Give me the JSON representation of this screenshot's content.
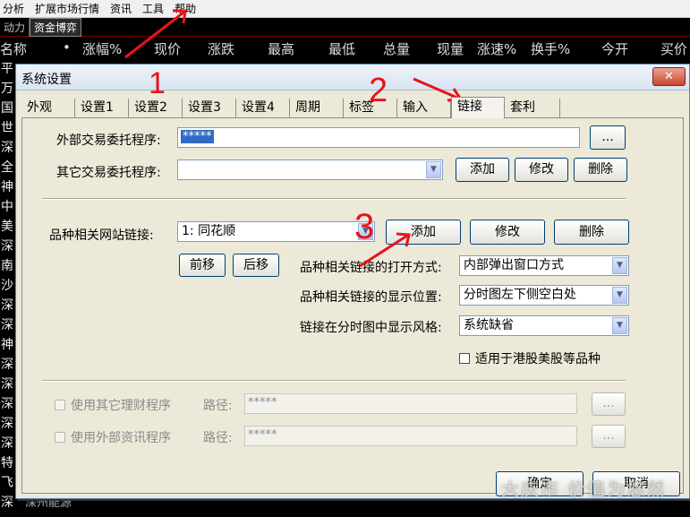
{
  "menubar": {
    "items": [
      "分析",
      "扩展市场行情",
      "资讯",
      "工具",
      "帮助"
    ]
  },
  "tabstrip": {
    "items": [
      "动力",
      "资金博弈"
    ]
  },
  "columns": [
    "名称",
    "•",
    "涨幅%",
    "现价",
    "涨跌",
    "最高",
    "最低",
    "总量",
    "现量",
    "涨速%",
    "换手%",
    "今开",
    "买价"
  ],
  "left_chars": [
    "平",
    "万",
    "国",
    "世",
    "深",
    "全",
    "神",
    "中",
    "美",
    "深",
    "南",
    "沙",
    "深",
    "深",
    "神",
    "深",
    "深",
    "深",
    "深",
    "深",
    "特",
    "飞",
    "深"
  ],
  "bottom_row_text": "深州能源",
  "dialog": {
    "title": "系统设置",
    "close_glyph": "✕",
    "tabs": [
      "外观",
      "设置1",
      "设置2",
      "设置3",
      "设置4",
      "周期",
      "标签",
      "输入",
      "链接",
      "套利"
    ],
    "active_tab": "链接",
    "external_program": {
      "label": "外部交易委托程序:",
      "value": "*****",
      "browse_label": "..."
    },
    "other_program": {
      "label": "其它交易委托程序:",
      "value": "",
      "add_label": "添加",
      "edit_label": "修改",
      "delete_label": "删除"
    },
    "website_link": {
      "label": "品种相关网站链接:",
      "value": "1: 同花顺",
      "add_label": "添加",
      "edit_label": "修改",
      "delete_label": "删除",
      "prev_label": "前移",
      "next_label": "后移"
    },
    "open_mode": {
      "label": "品种相关链接的打开方式:",
      "value": "内部弹出窗口方式"
    },
    "display_position": {
      "label": "品种相关链接的显示位置:",
      "value": "分时图左下侧空白处"
    },
    "display_style": {
      "label": "链接在分时图中显示风格:",
      "value": "系统缺省"
    },
    "hk_us_checkbox": {
      "label": "适用于港股美股等品种",
      "checked": false
    },
    "finance_program": {
      "checkbox_label": "使用其它理财程序",
      "path_label": "路径:",
      "value": "*****",
      "browse_label": "..."
    },
    "news_program": {
      "checkbox_label": "使用外部资讯程序",
      "path_label": "路径:",
      "value": "*****",
      "browse_label": "..."
    },
    "ok_label": "确定",
    "cancel_label": "取消"
  },
  "annotations": {
    "numbers": [
      "1",
      "2",
      "3"
    ],
    "color": "#e8121c"
  },
  "watermark": "大庆市 价值为悠然",
  "colors": {
    "accent_red": "#e8121c",
    "selection_blue": "#316ac5",
    "dialog_bg": "#ece9d8"
  }
}
